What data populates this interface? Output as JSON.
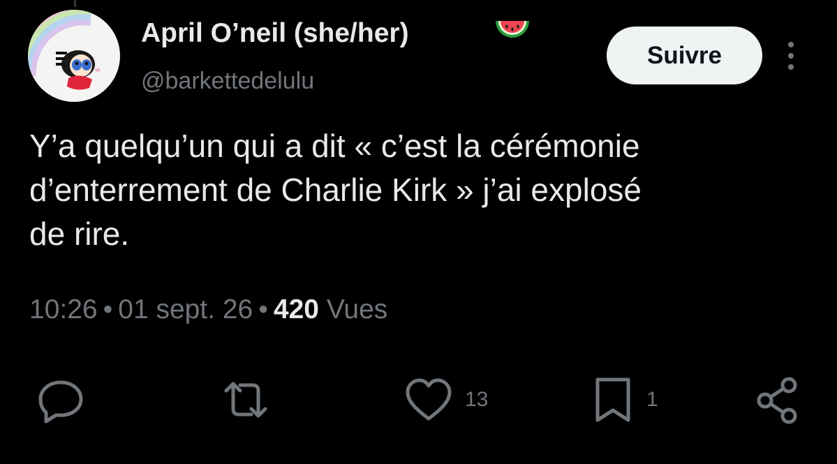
{
  "tweet": {
    "author": {
      "display_name": "April O’neil (she/her)",
      "handle": "@barkettedelulu",
      "emoji_icon": "watermelon-icon"
    },
    "follow_label": "Suivre",
    "text": "Y’a quelqu’un qui a dit « c’est la cérémonie\nd’enterrement de Charlie Kirk » j’ai explosé\nde rire.",
    "time": "10:26",
    "date": "01 sept. 26",
    "separator": "•",
    "views_count": "420",
    "views_label": "Vues"
  },
  "actions": {
    "reply": {
      "icon": "reply-icon"
    },
    "retweet": {
      "icon": "retweet-icon"
    },
    "like": {
      "icon": "heart-icon",
      "count": "13"
    },
    "bookmark": {
      "icon": "bookmark-icon",
      "count": "1"
    },
    "share": {
      "icon": "share-icon"
    }
  },
  "colors": {
    "background": "#000000",
    "primary_text": "#e7e9ea",
    "secondary_text": "#71767b",
    "follow_button_bg": "#eff3f4",
    "follow_button_text": "#0f1419"
  }
}
